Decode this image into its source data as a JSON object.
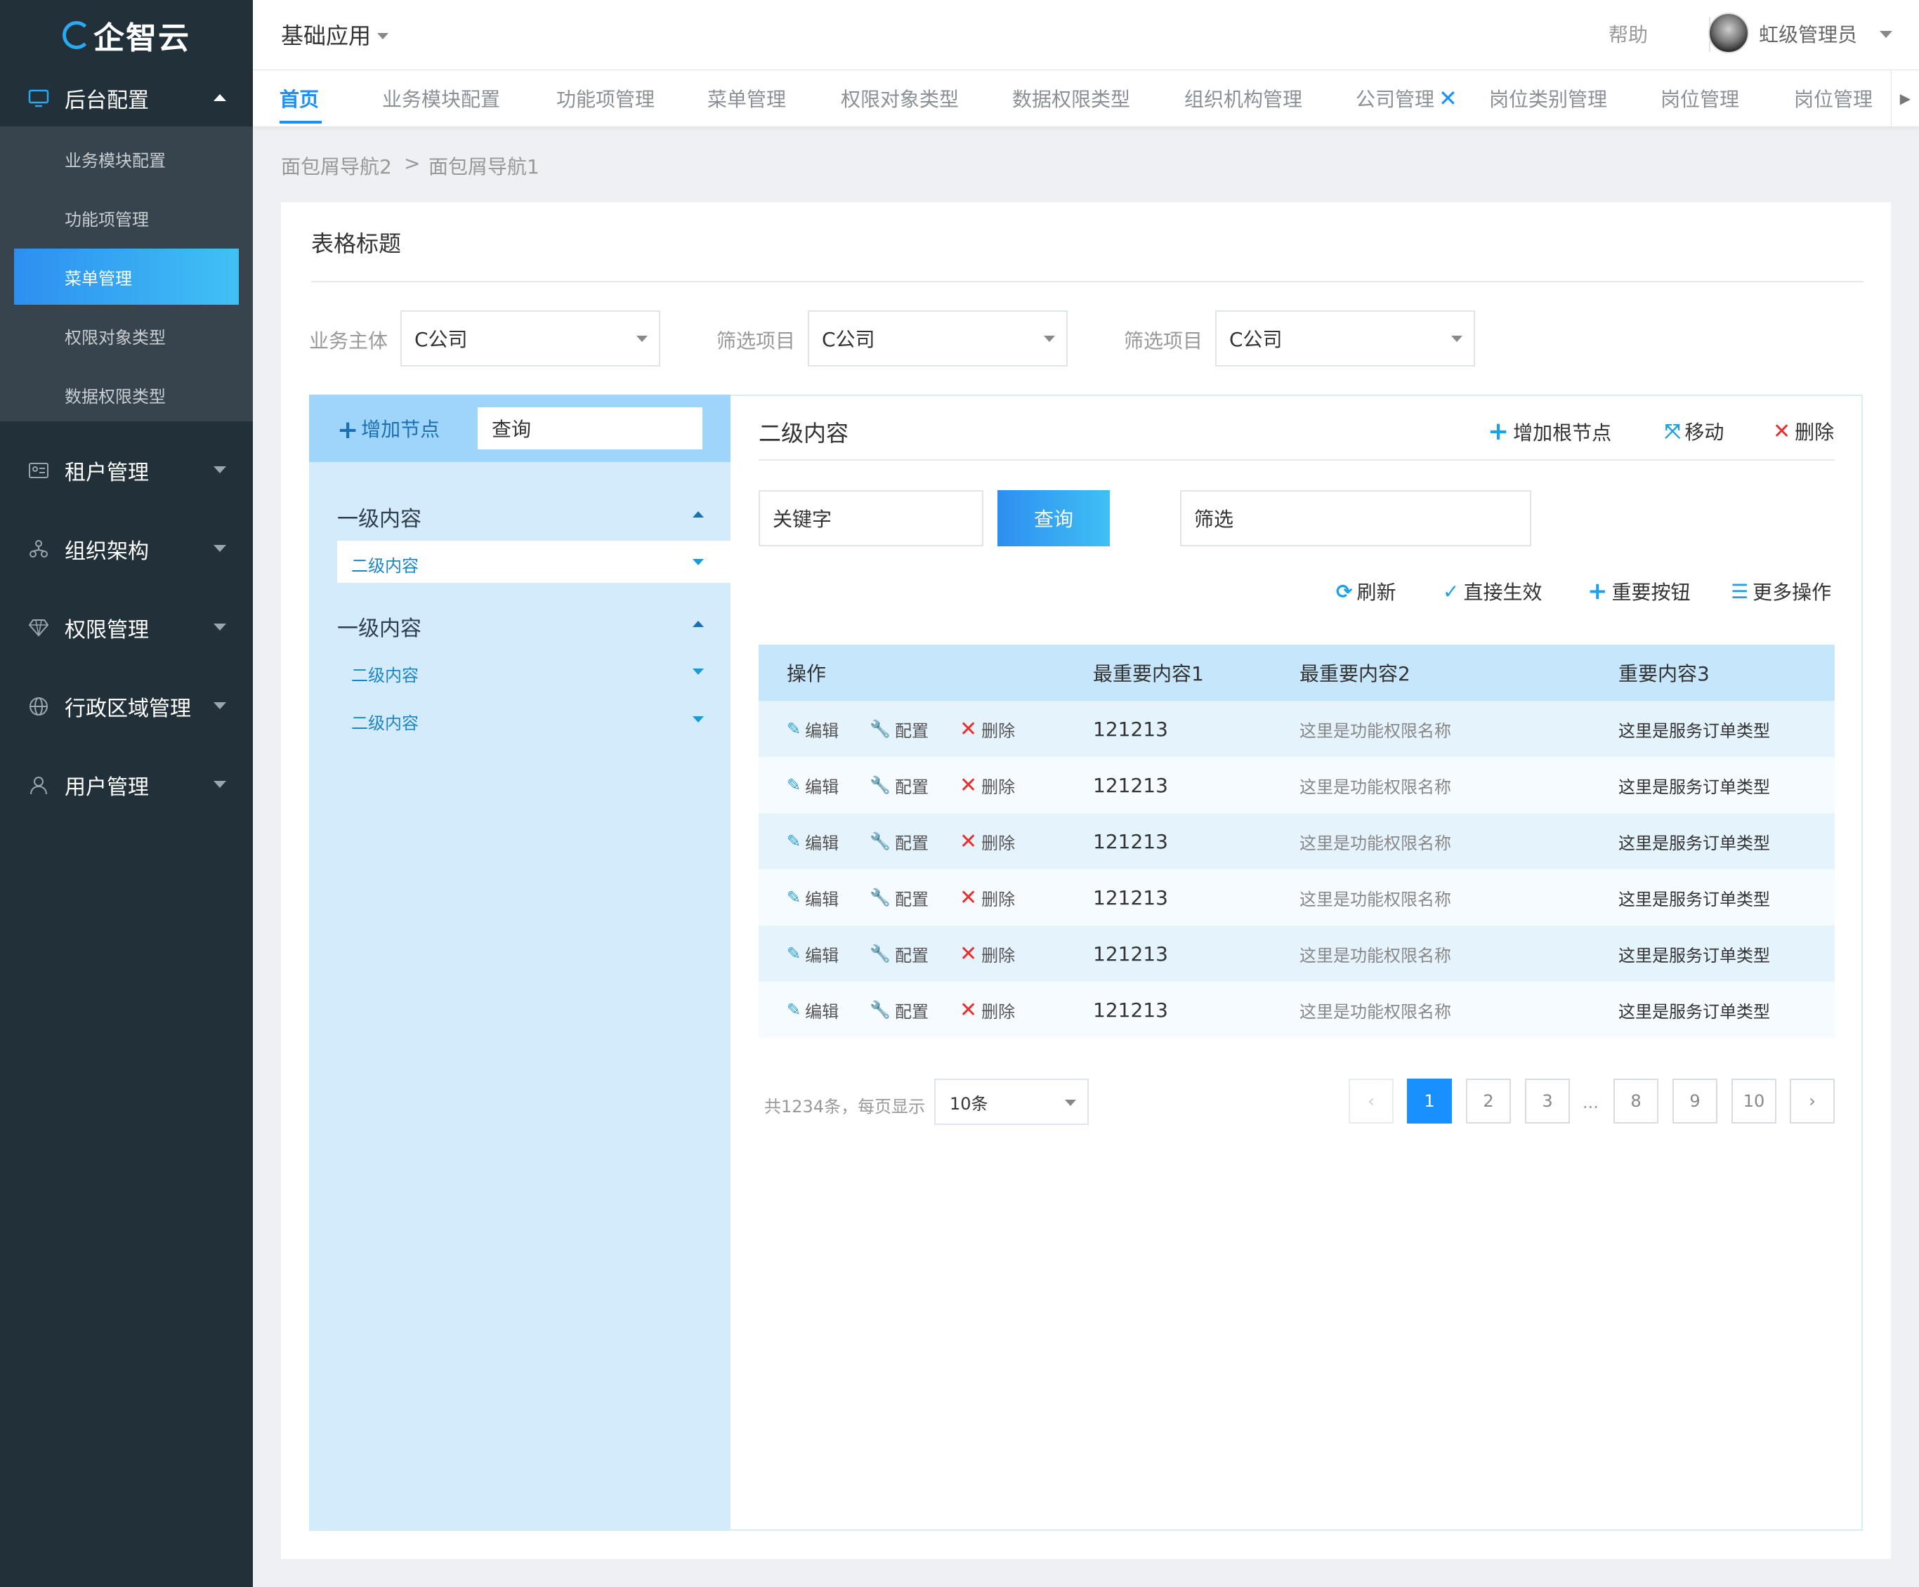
{
  "sidebar": {
    "logo": "企智云",
    "groups": [
      {
        "label": "后台配置",
        "icon": "monitor-icon",
        "expanded": true,
        "items": [
          "业务模块配置",
          "功能项管理",
          "菜单管理",
          "权限对象类型",
          "数据权限类型"
        ],
        "active_item": "菜单管理"
      },
      {
        "label": "租户管理",
        "icon": "id-card-icon"
      },
      {
        "label": "组织架构",
        "icon": "org-chart-icon"
      },
      {
        "label": "权限管理",
        "icon": "diamond-icon"
      },
      {
        "label": "行政区域管理",
        "icon": "globe-icon"
      },
      {
        "label": "用户管理",
        "icon": "user-icon"
      }
    ]
  },
  "header": {
    "app_title": "基础应用",
    "help": "帮助",
    "user_name": "虹级管理员"
  },
  "tabs": [
    {
      "label": "首页",
      "active": true
    },
    {
      "label": "业务模块配置"
    },
    {
      "label": "功能项管理"
    },
    {
      "label": "菜单管理"
    },
    {
      "label": "权限对象类型"
    },
    {
      "label": "数据权限类型"
    },
    {
      "label": "组织机构管理"
    },
    {
      "label": "公司管理",
      "closable": true
    },
    {
      "label": "岗位类别管理"
    },
    {
      "label": "岗位管理"
    },
    {
      "label": "岗位管理"
    }
  ],
  "breadcrumb": {
    "items": [
      "面包屑导航2",
      "面包屑导航1"
    ],
    "separator": ">"
  },
  "card": {
    "title": "表格标题",
    "filters": [
      {
        "label": "业务主体",
        "value": "C公司"
      },
      {
        "label": "筛选项目",
        "value": "C公司"
      },
      {
        "label": "筛选项目",
        "value": "C公司"
      }
    ]
  },
  "tree": {
    "add_node": "增加节点",
    "search_value": "查询",
    "level1": [
      {
        "label": "一级内容",
        "children": [
          "二级内容"
        ]
      },
      {
        "label": "一级内容",
        "children": [
          "二级内容",
          "二级内容"
        ]
      }
    ]
  },
  "panel": {
    "title": "二级内容",
    "actions": {
      "add_root": "增加根节点",
      "move": "移动",
      "delete": "删除"
    },
    "keyword_value": "关键字",
    "query": "查询",
    "filter_value": "筛选",
    "toolbar": {
      "refresh": "刷新",
      "apply": "直接生效",
      "important": "重要按钮",
      "more": "更多操作"
    }
  },
  "table": {
    "headers": [
      "操作",
      "最重要内容1",
      "最重要内容2",
      "重要内容3"
    ],
    "ops": {
      "edit": "编辑",
      "config": "配置",
      "delete": "删除"
    },
    "rows": [
      [
        "121213",
        "这里是功能权限名称",
        "这里是服务订单类型"
      ],
      [
        "121213",
        "这里是功能权限名称",
        "这里是服务订单类型"
      ],
      [
        "121213",
        "这里是功能权限名称",
        "这里是服务订单类型"
      ],
      [
        "121213",
        "这里是功能权限名称",
        "这里是服务订单类型"
      ],
      [
        "121213",
        "这里是功能权限名称",
        "这里是服务订单类型"
      ],
      [
        "121213",
        "这里是功能权限名称",
        "这里是服务订单类型"
      ]
    ]
  },
  "pagination": {
    "total_text": "共1234条，每页显示",
    "page_size": "10条",
    "pages": [
      "1",
      "2",
      "3",
      "8",
      "9",
      "10"
    ],
    "current": "1",
    "ellipsis": "..."
  },
  "colors": {
    "accent": "#1890ff",
    "sidebar_bg": "#223039",
    "tree_bg": "#d4ebfc",
    "danger": "#ef2b2b"
  }
}
